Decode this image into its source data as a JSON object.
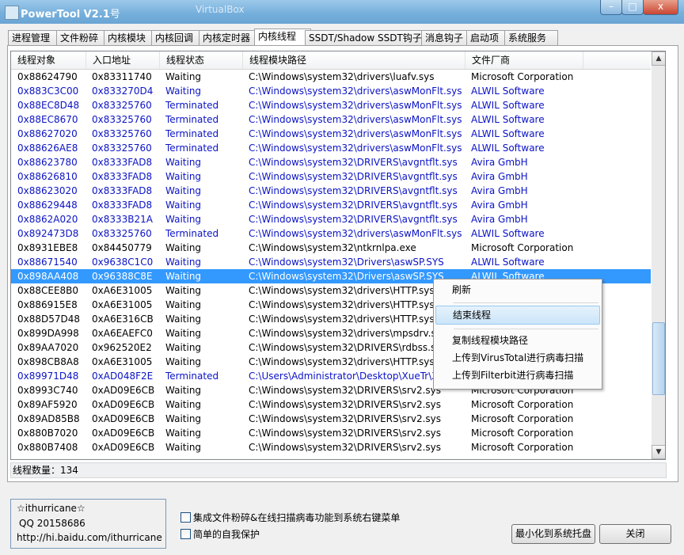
{
  "window": {
    "title": "PowerTool V2.1",
    "title_suffix": "号",
    "background_text": "VirtualBox",
    "controls": {
      "minimize": "–",
      "maximize": "□",
      "close": "x"
    }
  },
  "tabs": [
    {
      "label": "进程管理"
    },
    {
      "label": "文件粉碎"
    },
    {
      "label": "内核模块"
    },
    {
      "label": "内核回调"
    },
    {
      "label": "内核定时器"
    },
    {
      "label": "内核线程",
      "active": true
    },
    {
      "label": "SSDT/Shadow SSDT钩子"
    },
    {
      "label": "消息钩子"
    },
    {
      "label": "启动项"
    },
    {
      "label": "系统服务"
    }
  ],
  "table": {
    "columns": [
      "线程对象",
      "入口地址",
      "线程状态",
      "线程模块路径",
      "文件厂商"
    ],
    "rows": [
      {
        "obj": "0x88624790",
        "entry": "0x83311740",
        "state": "Waiting",
        "path": "C:\\Windows\\system32\\drivers\\luafv.sys",
        "vendor": "Microsoft Corporation",
        "color": "black"
      },
      {
        "obj": "0x883C3C00",
        "entry": "0x833270D4",
        "state": "Waiting",
        "path": "C:\\Windows\\system32\\drivers\\aswMonFlt.sys",
        "vendor": "ALWIL Software",
        "color": "blue"
      },
      {
        "obj": "0x88EC8D48",
        "entry": "0x83325760",
        "state": "Terminated",
        "path": "C:\\Windows\\system32\\drivers\\aswMonFlt.sys",
        "vendor": "ALWIL Software",
        "color": "blue"
      },
      {
        "obj": "0x88EC8670",
        "entry": "0x83325760",
        "state": "Terminated",
        "path": "C:\\Windows\\system32\\drivers\\aswMonFlt.sys",
        "vendor": "ALWIL Software",
        "color": "blue"
      },
      {
        "obj": "0x88627020",
        "entry": "0x83325760",
        "state": "Terminated",
        "path": "C:\\Windows\\system32\\drivers\\aswMonFlt.sys",
        "vendor": "ALWIL Software",
        "color": "blue"
      },
      {
        "obj": "0x88626AE8",
        "entry": "0x83325760",
        "state": "Terminated",
        "path": "C:\\Windows\\system32\\drivers\\aswMonFlt.sys",
        "vendor": "ALWIL Software",
        "color": "blue"
      },
      {
        "obj": "0x88623780",
        "entry": "0x8333FAD8",
        "state": "Waiting",
        "path": "C:\\Windows\\system32\\DRIVERS\\avgntflt.sys",
        "vendor": "Avira GmbH",
        "color": "blue"
      },
      {
        "obj": "0x88626810",
        "entry": "0x8333FAD8",
        "state": "Waiting",
        "path": "C:\\Windows\\system32\\DRIVERS\\avgntflt.sys",
        "vendor": "Avira GmbH",
        "color": "blue"
      },
      {
        "obj": "0x88623020",
        "entry": "0x8333FAD8",
        "state": "Waiting",
        "path": "C:\\Windows\\system32\\DRIVERS\\avgntflt.sys",
        "vendor": "Avira GmbH",
        "color": "blue"
      },
      {
        "obj": "0x88629448",
        "entry": "0x8333FAD8",
        "state": "Waiting",
        "path": "C:\\Windows\\system32\\DRIVERS\\avgntflt.sys",
        "vendor": "Avira GmbH",
        "color": "blue"
      },
      {
        "obj": "0x8862A020",
        "entry": "0x8333B21A",
        "state": "Waiting",
        "path": "C:\\Windows\\system32\\DRIVERS\\avgntflt.sys",
        "vendor": "Avira GmbH",
        "color": "blue"
      },
      {
        "obj": "0x892473D8",
        "entry": "0x83325760",
        "state": "Terminated",
        "path": "C:\\Windows\\system32\\drivers\\aswMonFlt.sys",
        "vendor": "ALWIL Software",
        "color": "blue"
      },
      {
        "obj": "0x8931EBE8",
        "entry": "0x84450779",
        "state": "Waiting",
        "path": "C:\\Windows\\system32\\ntkrnlpa.exe",
        "vendor": "Microsoft Corporation",
        "color": "black"
      },
      {
        "obj": "0x88671540",
        "entry": "0x9638C1C0",
        "state": "Waiting",
        "path": "C:\\Windows\\system32\\Drivers\\aswSP.SYS",
        "vendor": "ALWIL Software",
        "color": "blue"
      },
      {
        "obj": "0x898AA408",
        "entry": "0x96388C8E",
        "state": "Waiting",
        "path": "C:\\Windows\\system32\\Drivers\\aswSP.SYS",
        "vendor": "ALWIL Software",
        "color": "sel"
      },
      {
        "obj": "0x88CEE8B0",
        "entry": "0xA6E31005",
        "state": "Waiting",
        "path": "C:\\Windows\\system32\\drivers\\HTTP.sys",
        "vendor": "",
        "color": "black"
      },
      {
        "obj": "0x886915E8",
        "entry": "0xA6E31005",
        "state": "Waiting",
        "path": "C:\\Windows\\system32\\drivers\\HTTP.sys",
        "vendor": "",
        "color": "black"
      },
      {
        "obj": "0x88D57D48",
        "entry": "0xA6E316CB",
        "state": "Waiting",
        "path": "C:\\Windows\\system32\\drivers\\HTTP.sys",
        "vendor": "",
        "color": "black"
      },
      {
        "obj": "0x899DA998",
        "entry": "0xA6EAEFC0",
        "state": "Waiting",
        "path": "C:\\Windows\\system32\\drivers\\mpsdrv.sys",
        "vendor": "",
        "color": "black"
      },
      {
        "obj": "0x89AA7020",
        "entry": "0x962520E2",
        "state": "Waiting",
        "path": "C:\\Windows\\system32\\DRIVERS\\rdbss.sys",
        "vendor": "",
        "color": "black"
      },
      {
        "obj": "0x898CB8A8",
        "entry": "0xA6E31005",
        "state": "Waiting",
        "path": "C:\\Windows\\system32\\drivers\\HTTP.sys",
        "vendor": "",
        "color": "black"
      },
      {
        "obj": "0x89971D48",
        "entry": "0xAD048F2E",
        "state": "Terminated",
        "path": "C:\\Users\\Administrator\\Desktop\\XueTr\\Xue",
        "vendor": "",
        "color": "blue"
      },
      {
        "obj": "0x8993C740",
        "entry": "0xAD09E6CB",
        "state": "Waiting",
        "path": "C:\\Windows\\system32\\DRIVERS\\srv2.sys",
        "vendor": "Microsoft Corporation",
        "color": "black"
      },
      {
        "obj": "0x89AF5920",
        "entry": "0xAD09E6CB",
        "state": "Waiting",
        "path": "C:\\Windows\\system32\\DRIVERS\\srv2.sys",
        "vendor": "Microsoft Corporation",
        "color": "black"
      },
      {
        "obj": "0x89AD85B8",
        "entry": "0xAD09E6CB",
        "state": "Waiting",
        "path": "C:\\Windows\\system32\\DRIVERS\\srv2.sys",
        "vendor": "Microsoft Corporation",
        "color": "black"
      },
      {
        "obj": "0x880B7020",
        "entry": "0xAD09E6CB",
        "state": "Waiting",
        "path": "C:\\Windows\\system32\\DRIVERS\\srv2.sys",
        "vendor": "Microsoft Corporation",
        "color": "black"
      },
      {
        "obj": "0x880B7408",
        "entry": "0xAD09E6CB",
        "state": "Waiting",
        "path": "C:\\Windows\\system32\\DRIVERS\\srv2.sys",
        "vendor": "Microsoft Corporation",
        "color": "black"
      }
    ]
  },
  "status": {
    "text": "线程数量：134"
  },
  "context_menu": {
    "items": [
      "刷新",
      "结束线程",
      "复制线程模块路径",
      "上传到VirusTotal进行病毒扫描",
      "上传到Filterbit进行病毒扫描"
    ]
  },
  "about": {
    "author": "☆ithurricane☆",
    "qq": "QQ 20158686",
    "url": "http://hi.baidu.com/ithurricane"
  },
  "options": {
    "shell_menu": "集成文件粉碎&在线扫描病毒功能到系统右键菜单",
    "self_protect": "简单的自我保护"
  },
  "buttons": {
    "minimize_tray": "最小化到系统托盘",
    "close": "关闭"
  },
  "colors": {
    "blue_text": "#0b13c4",
    "selection": "#3399ff",
    "title_bar": "#74aedb"
  }
}
